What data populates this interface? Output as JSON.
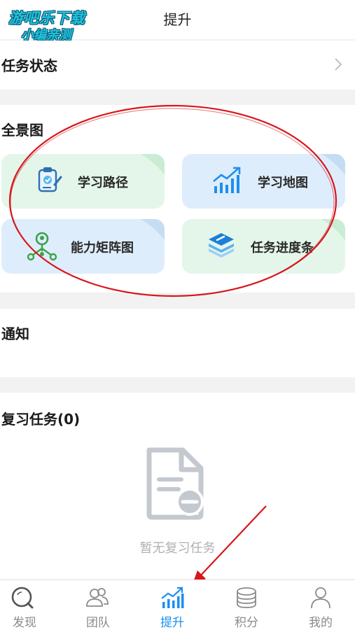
{
  "header": {
    "title": "提升"
  },
  "watermark": {
    "line1": "游吧乐下载",
    "line2": "小编亲测"
  },
  "task_status": {
    "label": "任务状态",
    "icon": "chevron-right-icon"
  },
  "panorama": {
    "label": "全景图",
    "cards": [
      {
        "label": "学习路径",
        "icon": "clipboard-check-icon"
      },
      {
        "label": "学习地图",
        "icon": "growth-chart-icon"
      },
      {
        "label": "能力矩阵图",
        "icon": "network-nodes-icon"
      },
      {
        "label": "任务进度条",
        "icon": "stacked-layers-icon"
      }
    ]
  },
  "notice": {
    "label": "通知"
  },
  "review": {
    "label": "复习任务(0)",
    "empty_text": "暂无复习任务",
    "icon": "document-minus-icon"
  },
  "tabbar": {
    "tabs": [
      {
        "label": "发现",
        "icon": "magnifier-icon",
        "active": false
      },
      {
        "label": "团队",
        "icon": "team-icon",
        "active": false
      },
      {
        "label": "提升",
        "icon": "growth-chart-icon",
        "active": true
      },
      {
        "label": "积分",
        "icon": "coins-icon",
        "active": false
      },
      {
        "label": "我的",
        "icon": "user-icon",
        "active": false
      }
    ]
  },
  "colors": {
    "accent": "#1c8ff0",
    "annotation_red": "#d8161b",
    "card_green": "#e4f6ea",
    "card_blue": "#deedfb",
    "inactive_text": "#8a8a8a"
  }
}
